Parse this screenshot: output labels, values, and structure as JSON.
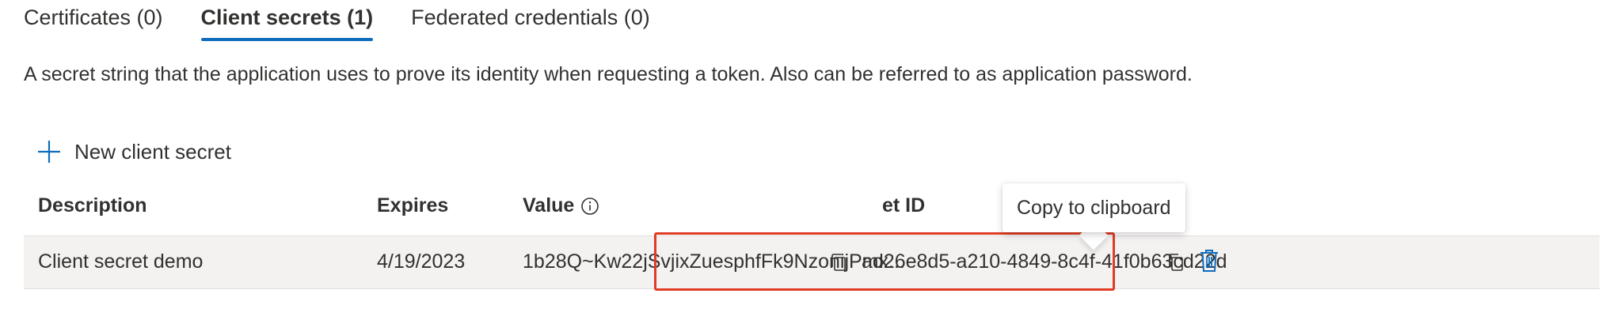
{
  "tabs": [
    {
      "label": "Certificates (0)",
      "active": false
    },
    {
      "label": "Client secrets (1)",
      "active": true
    },
    {
      "label": "Federated credentials (0)",
      "active": false
    }
  ],
  "description": "A secret string that the application uses to prove its identity when requesting a token. Also can be referred to as application password.",
  "toolbar": {
    "new_secret_label": "New client secret"
  },
  "table": {
    "headers": {
      "description": "Description",
      "expires": "Expires",
      "value": "Value",
      "secret_id": "et ID"
    },
    "rows": [
      {
        "description": "Client secret demo",
        "expires": "4/19/2023",
        "value": "1b28Q~Kw22jSvjixZuesphfFk9NzonijPmx...",
        "secret_id": "ad26e8d5-a210-4849-8c4f-41f0b63cd22d"
      }
    ]
  },
  "tooltip": {
    "text": "Copy to clipboard"
  },
  "colors": {
    "accent": "#0f6cbd",
    "highlight": "#e03b24",
    "row_bg": "#f3f2f1"
  },
  "icons": {
    "add": "plus-icon",
    "info": "info-icon",
    "copy": "copy-icon",
    "delete": "trash-icon"
  }
}
